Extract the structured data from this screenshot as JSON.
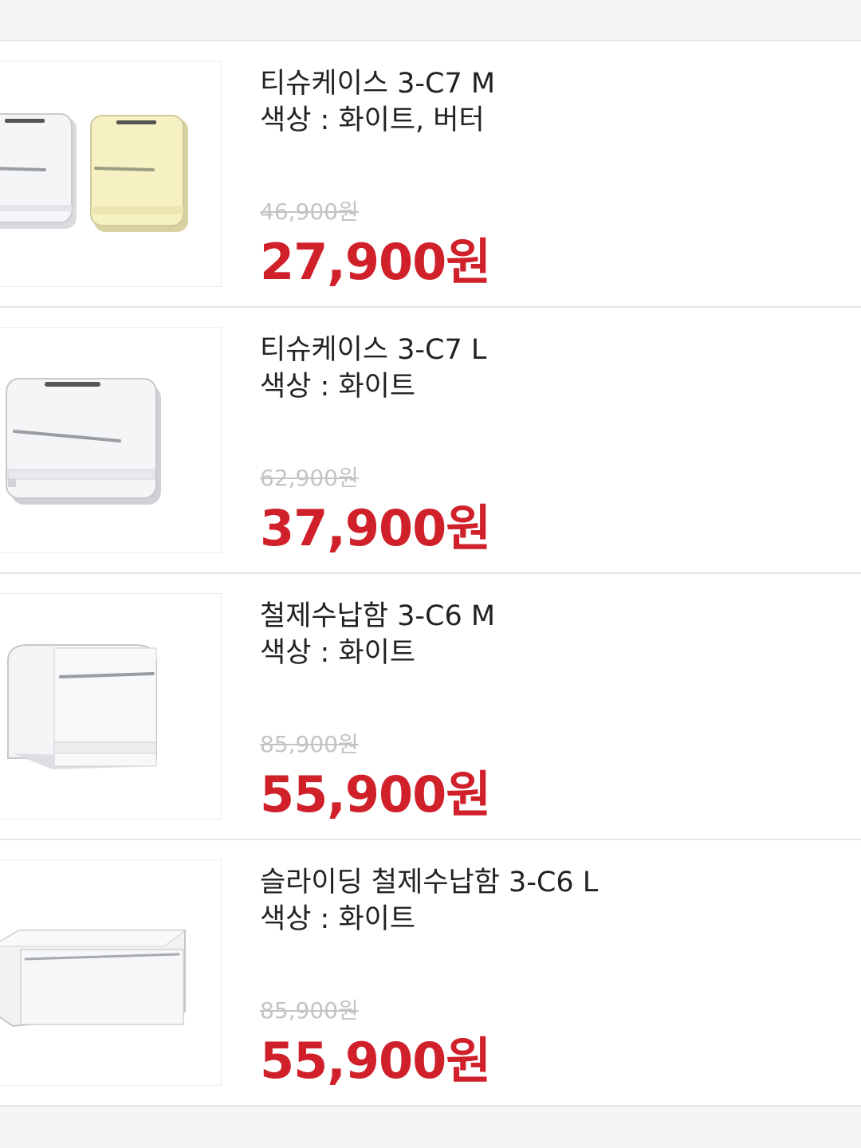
{
  "products": [
    {
      "name": "티슈케이스 3-C7 M",
      "color_text": "색상 : 화이트, 버터",
      "original_price": "46,900원",
      "sale_price": "27,900원",
      "image": "tissue-case-m-white-butter",
      "body_colors": [
        "#f4f5f7",
        "#f6f1c2"
      ]
    },
    {
      "name": "티슈케이스 3-C7 L",
      "color_text": "색상 : 화이트",
      "original_price": "62,900원",
      "sale_price": "37,900원",
      "image": "tissue-case-l-white",
      "body_colors": [
        "#f4f5f7"
      ]
    },
    {
      "name": "철제수납함 3-C6 M",
      "color_text": "색상 : 화이트",
      "original_price": "85,900원",
      "sale_price": "55,900원",
      "image": "steel-storage-box-m-white",
      "body_colors": [
        "#f4f5f7"
      ]
    },
    {
      "name": "슬라이딩 철제수납함 3-C6 L",
      "color_text": "색상 : 화이트",
      "original_price": "85,900원",
      "sale_price": "55,900원",
      "image": "sliding-steel-storage-box-l-white",
      "body_colors": [
        "#f4f5f7"
      ]
    }
  ],
  "colors": {
    "sale_price": "#d0202a",
    "original_price": "#c4c4c4",
    "text": "#222222",
    "divider": "#e6e6e6"
  }
}
